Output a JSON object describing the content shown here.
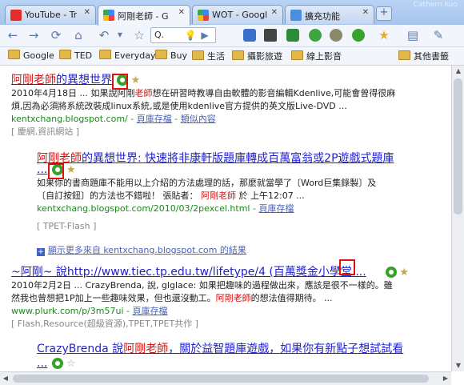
{
  "window": {
    "user": "Cathern Kuo"
  },
  "tabs": [
    {
      "label": "YouTube - Tr",
      "icon": "youtube-icon",
      "active": false
    },
    {
      "label": "阿剛老師 - G",
      "icon": "google-icon",
      "active": true
    },
    {
      "label": "WOT - Googl",
      "icon": "google-icon",
      "active": false
    },
    {
      "label": "擴充功能",
      "icon": "puzzle-icon",
      "active": false
    }
  ],
  "toolbar": {
    "omnibox_text": "Q."
  },
  "bookmarks": [
    "Google",
    "TED",
    "Everyday",
    "Buy",
    "生活",
    "攝影旅遊",
    "線上影音"
  ],
  "bookmarks_other": "其他書籤",
  "results": [
    {
      "title_hl": "阿剛老師",
      "title_rest": "的異想世界",
      "snippet_date": "2010年4月18日",
      "snippet_l1_a": " ... 如果說阿剛",
      "snippet_l1_hl": "老師",
      "snippet_l1_b": "想在研習時教導自由軟體的影音編輯Kdenlive,可能會曾得很麻",
      "snippet_l2": "煩,因為必須將系統改裝成linux系統,或是使用kdenlive官方提供的英文版Live-DVD ...",
      "url": "kentxchang.blogspot.com/",
      "cache": "頁庫存檔",
      "similar": "類似內容",
      "label": "[ 慶網,資訊網站 ]"
    },
    {
      "title_hl": "阿剛老師",
      "title_rest": "的異想世界: 快速將非康軒版題庫轉成百萬富翁或2P遊戲式題庫",
      "ellipsis": "...",
      "snippet_l1": "如果你的書商題庫不能用以上介紹的方法處理的話，那麼就當學了〔Word巨集錄製〕及",
      "snippet_l2_a": "〔自訂按鈕〕的方法也不錯啦！ 張貼者： ",
      "snippet_l2_hl": "阿剛老師",
      "snippet_l2_b": " 於 上午12:07 ...",
      "url": "kentxchang.blogspot.com/2010/03/2pexcel.html",
      "cache": "頁庫存檔",
      "label": "[ TPET-Flash ]"
    },
    {
      "more_text": "顯示更多來自 kentxchang.blogspot.com 的結果"
    },
    {
      "title_a": "~阿剛~ 說http://www.tiec.tp.edu.tw/lifetype/4 (百萬獎金小學堂 ...",
      "snippet_l1": "2010年2月2日 ... CrazyBrenda, 說, glglace: 如果把趣味的過程做出來，應該是很不一樣的。雖",
      "snippet_l2_a": "然我也曾想把1P加上一些趣味效果，但也還沒動工。",
      "snippet_l2_hl": "阿剛老師",
      "snippet_l2_b": "的想法值得期待。 ...",
      "url": "www.plurk.com/p/3m57ui",
      "cache": "頁庫存檔",
      "label": "[ Flash,Resource(超級資源),TPET,TPET共作 ]"
    },
    {
      "title_a": "CrazyBrenda 說",
      "title_hl": "阿剛老師",
      "title_b": "，關於益智題庫遊戲，如果你有新點子想試試看",
      "ellipsis": "..."
    }
  ],
  "colors": {
    "link": "#2222cc",
    "highlight": "#d11111",
    "url": "#1a8a1a",
    "wot_green": "#37a12a",
    "marker": "#e01010"
  }
}
